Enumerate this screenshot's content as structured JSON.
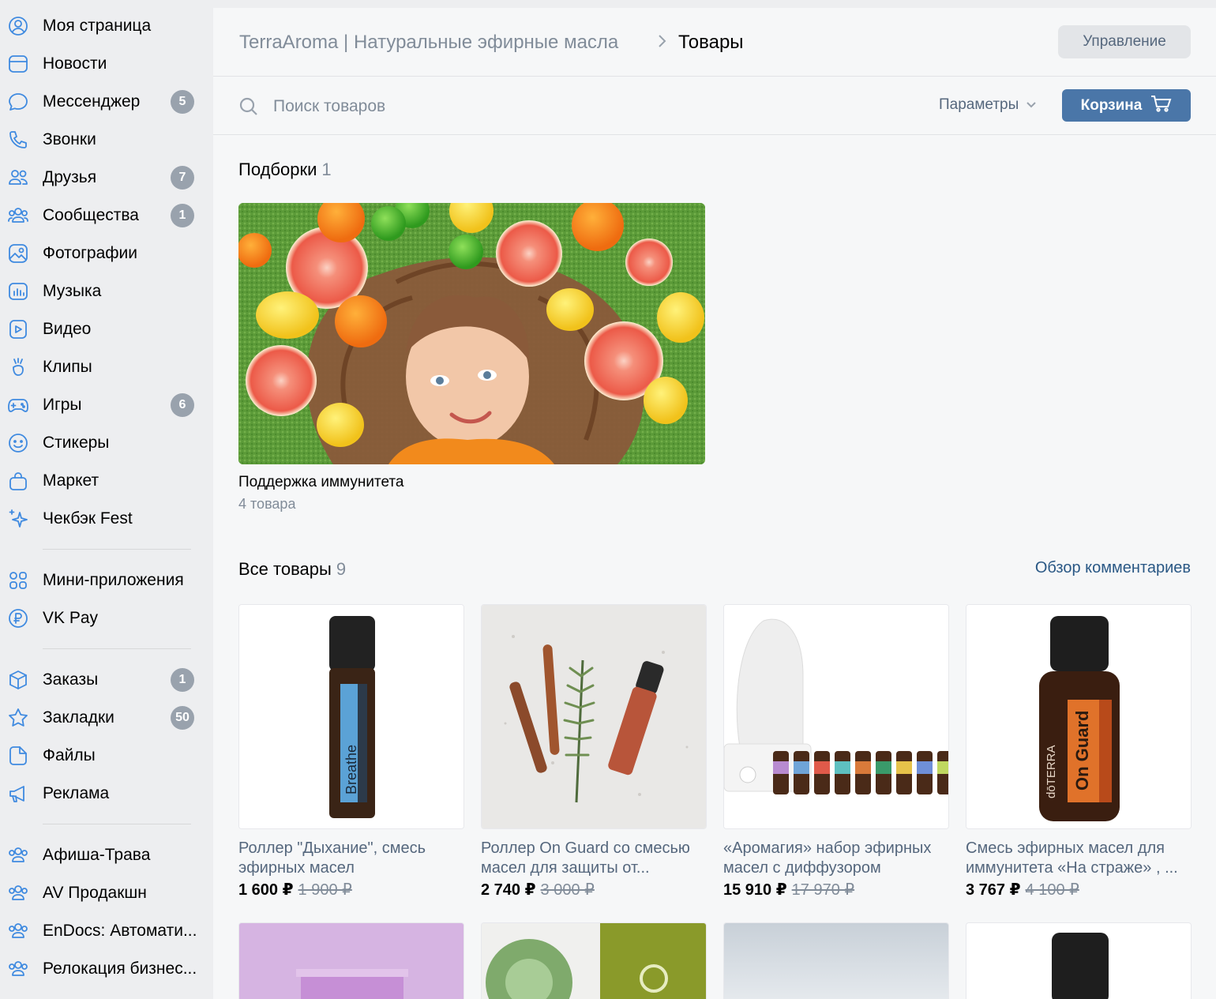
{
  "sidebar": {
    "items": [
      {
        "label": "Моя страница",
        "icon": "user-circle-icon",
        "badge": ""
      },
      {
        "label": "Новости",
        "icon": "newsfeed-icon",
        "badge": ""
      },
      {
        "label": "Мессенджер",
        "icon": "message-icon",
        "badge": "5"
      },
      {
        "label": "Звонки",
        "icon": "phone-icon",
        "badge": ""
      },
      {
        "label": "Друзья",
        "icon": "friends-icon",
        "badge": "7"
      },
      {
        "label": "Сообщества",
        "icon": "communities-icon",
        "badge": "1"
      },
      {
        "label": "Фотографии",
        "icon": "photo-icon",
        "badge": ""
      },
      {
        "label": "Музыка",
        "icon": "music-icon",
        "badge": ""
      },
      {
        "label": "Видео",
        "icon": "video-icon",
        "badge": ""
      },
      {
        "label": "Клипы",
        "icon": "clips-icon",
        "badge": ""
      },
      {
        "label": "Игры",
        "icon": "gamepad-icon",
        "badge": "6"
      },
      {
        "label": "Стикеры",
        "icon": "smile-icon",
        "badge": ""
      },
      {
        "label": "Маркет",
        "icon": "bag-icon",
        "badge": ""
      },
      {
        "label": "Чекбэк Fest",
        "icon": "sparkle-icon",
        "badge": ""
      },
      {
        "label": "Мини-приложения",
        "icon": "apps-icon",
        "badge": ""
      },
      {
        "label": "VK Pay",
        "icon": "ruble-icon",
        "badge": ""
      },
      {
        "label": "Заказы",
        "icon": "box-icon",
        "badge": "1"
      },
      {
        "label": "Закладки",
        "icon": "star-icon",
        "badge": "50"
      },
      {
        "label": "Файлы",
        "icon": "file-icon",
        "badge": ""
      },
      {
        "label": "Реклама",
        "icon": "megaphone-icon",
        "badge": ""
      },
      {
        "label": "Афиша-Трава",
        "icon": "group-icon",
        "badge": ""
      },
      {
        "label": "AV Продакшн",
        "icon": "group-icon",
        "badge": ""
      },
      {
        "label": "EnDocs: Автомати...",
        "icon": "group-icon",
        "badge": ""
      },
      {
        "label": "Релокация бизнес...",
        "icon": "group-icon",
        "badge": ""
      }
    ]
  },
  "header": {
    "group_name": "TerraAroma | Натуральные эфирные масла",
    "current": "Товары",
    "manage_label": "Управление"
  },
  "search": {
    "placeholder": "Поиск товаров",
    "params_label": "Параметры",
    "cart_label": "Корзина"
  },
  "collections": {
    "title": "Подборки",
    "count": "1",
    "items": [
      {
        "title": "Поддержка иммунитета",
        "subtitle": "4 товара"
      }
    ]
  },
  "products": {
    "title": "Все товары",
    "count": "9",
    "comments_link": "Обзор комментариев",
    "items": [
      {
        "title": "Роллер \"Дыхание\", смесь эфирных масел",
        "price": "1 600 ₽",
        "old_price": "1 900 ₽"
      },
      {
        "title": "Роллер On Guard со смесью масел для защиты от...",
        "price": "2 740 ₽",
        "old_price": "3 000 ₽"
      },
      {
        "title": "«Аромагия» набор эфирных масел с диффузором",
        "price": "15 910 ₽",
        "old_price": "17 970 ₽"
      },
      {
        "title": "Смесь эфирных масел для иммунитета «На страже» , ...",
        "price": "3 767 ₽",
        "old_price": "4 100 ₽"
      }
    ]
  },
  "colors": {
    "accent": "#4a76a8",
    "link": "#2a5885",
    "badge": "#99a2ad",
    "icon": "#3f8ae0"
  }
}
